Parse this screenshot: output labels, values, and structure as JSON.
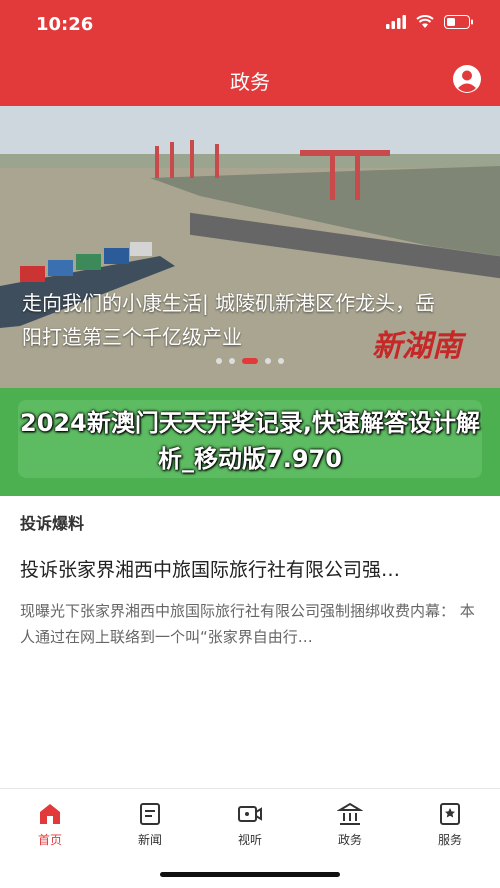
{
  "status": {
    "time": "10:26"
  },
  "header": {
    "title": "政务"
  },
  "banner": {
    "headline": "走向我们的小康生活| 城陵矶新港区作龙头，岳阳打造第三个千亿级产业",
    "watermark": "新湖南",
    "slide_count": 5,
    "active_slide": 3
  },
  "overlay": {
    "title": "2024新澳门天天开奖记录,快速解答设计解析_移动版7.970"
  },
  "section": {
    "title": "投诉爆料"
  },
  "article": {
    "title": "投诉张家界湘西中旅国际旅行社有限公司强…",
    "summary": "现曝光下张家界湘西中旅国际旅行社有限公司强制捆绑收费内幕：    本人通过在网上联络到一个叫“张家界自由行…"
  },
  "tabs": [
    {
      "label": "首页",
      "icon": "home-icon",
      "active": true
    },
    {
      "label": "新闻",
      "icon": "news-icon",
      "active": false
    },
    {
      "label": "视听",
      "icon": "video-icon",
      "active": false
    },
    {
      "label": "政务",
      "icon": "government-icon",
      "active": false
    },
    {
      "label": "服务",
      "icon": "service-icon",
      "active": false
    }
  ],
  "colors": {
    "brand": "#e23a3a",
    "green": "#4caf50"
  }
}
